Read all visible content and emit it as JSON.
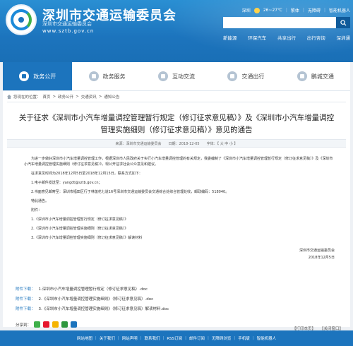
{
  "header": {
    "site_title": "深圳市交通运输委员会",
    "site_subtitle": "深圳市交通运输委员会",
    "site_url": "www.sztb.gov.cn",
    "topbar": {
      "city": "深圳",
      "temperature": "26~27℃",
      "traditional": "繁体",
      "accessibility": "无障碍",
      "mobile": "智能机器人"
    },
    "search": {
      "placeholder": "",
      "button_icon": "search-icon"
    },
    "quicklinks": [
      "新能源",
      "环保汽车",
      "共享出行",
      "出行咨询",
      "深圳通"
    ]
  },
  "nav": {
    "items": [
      {
        "label": "政务公开",
        "icon": "doc-icon",
        "active": true
      },
      {
        "label": "政务服务",
        "icon": "service-icon",
        "active": false
      },
      {
        "label": "互动交流",
        "icon": "chat-icon",
        "active": false
      },
      {
        "label": "交通出行",
        "icon": "travel-icon",
        "active": false
      },
      {
        "label": "鹏城交通",
        "icon": "city-icon",
        "active": false
      }
    ]
  },
  "breadcrumb": {
    "prefix": "您现在的位置：",
    "items": [
      "首页",
      "政务公开",
      "交通资讯",
      "通知公告"
    ],
    "sep": ">"
  },
  "article": {
    "title": "关于征求《深圳市小汽车增量调控管理暂行规定（修订征求意见稿）》及《深圳市小汽车增量调控管理实施细则（修订征求意见稿）》意见的通告",
    "meta": {
      "source": "来源：深圳市交通运输委员会",
      "date": "日期：2018-12-05",
      "font_size": "字体：【 大 中 小 】"
    },
    "paragraphs": [
      "为进一步做好深圳市小汽车增量调控管理工作，根据深圳市人民政府关于实行小汽车增量调控管理的有关规定，我委编制了《深圳市小汽车增量调控管理暂行规定（修订征求意见稿）》及《深圳市小汽车增量调控管理实施细则（修订征求意见稿）》，现公开征求社会公众意见和建议。",
      "征求意见时间为2018年12月5日至2018年12月15日，联系方式如下：",
      "1.电子邮件发送至：yangdt@sztb.gov.cn；",
      "2.书面意见邮寄至：深圳市福田区行于林莲花七道16号深圳市交通运输委员会交通综合处综合管理处收，邮政编码：518040。",
      "特此通告。",
      "附件："
    ],
    "attachments_list": [
      "1.《深圳市小汽车增量调控管理暂行规定（修订征求意见稿）》",
      "2.《深圳市小汽车增量调控管理实施细则（修订征求意见稿）》",
      "3.《深圳市小汽车增量调控管理实施细则（修订征求意见稿）》解读材料"
    ],
    "signature": "深圳市交通运输委员会",
    "sign_date": "2018年12月5日"
  },
  "downloads": {
    "label": "附件下载：",
    "files": [
      "1.深圳市小汽车增量调控管理暂行规定（修订征求意见稿）.doc",
      "2.《深圳市小汽车增量调控管理实施细则》（修订征求意见稿）.doc",
      "3.《深圳市小汽车增量调控管理实施细则》（修订征求意见稿）解读材料.doc"
    ]
  },
  "share": {
    "label": "分享到：",
    "icons": [
      "wechat-icon",
      "weibo-icon",
      "qzone-icon",
      "douban-icon",
      "more-icon"
    ]
  },
  "actions": {
    "print": "【打印本页】",
    "close": "【关闭窗口】"
  },
  "footer": {
    "links": [
      "网站地图",
      "关于我们",
      "网站声明",
      "联系我们",
      "RSS订阅",
      "邮件订阅",
      "无障碍浏览",
      "手机版",
      "智能机器人"
    ]
  },
  "colors": {
    "brand": "#1c74bd",
    "link": "#1c74bd"
  }
}
